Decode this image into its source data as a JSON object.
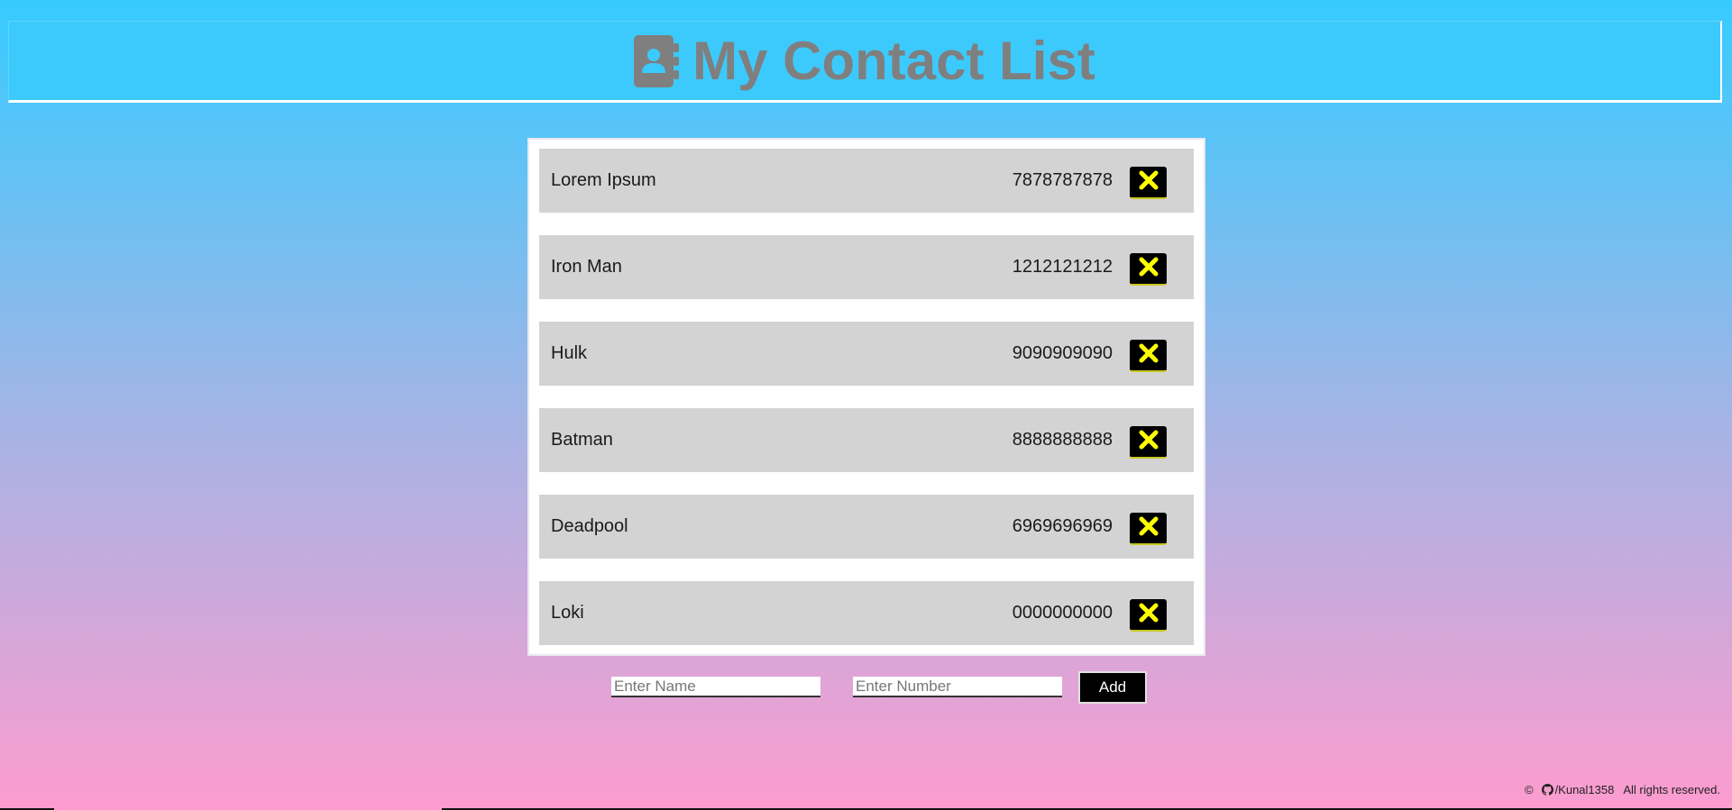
{
  "header": {
    "title": "My Contact List",
    "icon": "address-book-icon"
  },
  "contacts": [
    {
      "name": "Lorem Ipsum",
      "number": "7878787878"
    },
    {
      "name": "Iron Man",
      "number": "1212121212"
    },
    {
      "name": "Hulk",
      "number": "9090909090"
    },
    {
      "name": "Batman",
      "number": "8888888888"
    },
    {
      "name": "Deadpool",
      "number": "6969696969"
    },
    {
      "name": "Loki",
      "number": "0000000000"
    }
  ],
  "form": {
    "name_placeholder": "Enter Name",
    "number_placeholder": "Enter Number",
    "add_label": "Add"
  },
  "footer": {
    "copyright": "©",
    "github_handle": "/Kunal1358",
    "rights": "All rights reserved."
  },
  "colors": {
    "gradient_top": "#36cbff",
    "gradient_bottom": "#fd9ccf",
    "header_title": "#7f7f7f",
    "row_background": "#d3d3d3",
    "delete_icon": "#ffff00"
  }
}
